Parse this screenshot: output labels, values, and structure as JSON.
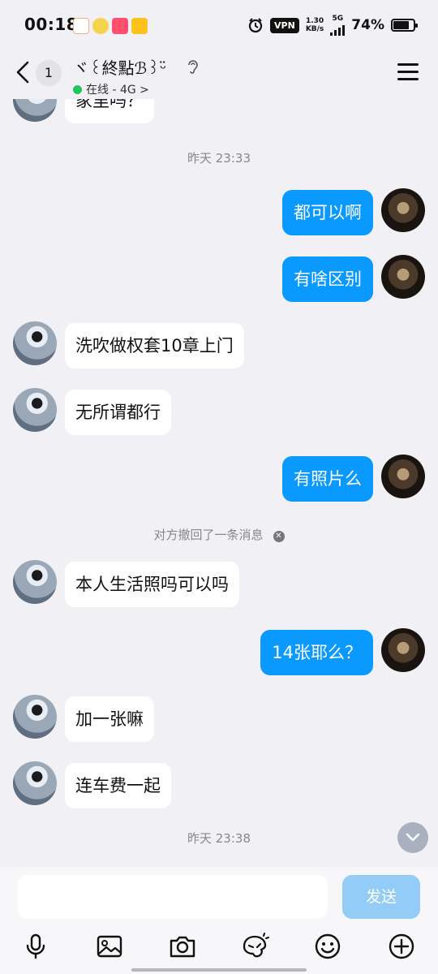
{
  "status_bar": {
    "time": "00:18",
    "vpn": "VPN",
    "speed_value": "1.30",
    "speed_unit": "KB/s",
    "network": "5G",
    "battery": "74%"
  },
  "header": {
    "back_count": "1",
    "chat_name": "ヾ꒰終點ℬ꒱ᵕ̈",
    "status_text": "在线 - 4G >"
  },
  "messages": [
    {
      "side": "left",
      "text": "家里吗？"
    },
    {
      "type": "time",
      "text": "昨天 23:33"
    },
    {
      "side": "right",
      "text": "都可以啊"
    },
    {
      "side": "right",
      "text": "有啥区别"
    },
    {
      "side": "left",
      "text": "洗吹做权套10章上门"
    },
    {
      "side": "left",
      "text": "无所谓都行"
    },
    {
      "side": "right",
      "text": "有照片么"
    },
    {
      "type": "recall",
      "text": "对方撤回了一条消息"
    },
    {
      "side": "left",
      "text": "本人生活照吗可以吗"
    },
    {
      "side": "right",
      "text": "14张耶么？"
    },
    {
      "side": "left",
      "text": "加一张嘛"
    },
    {
      "side": "left",
      "text": "连车费一起"
    },
    {
      "type": "time",
      "text": "昨天 23:38"
    }
  ],
  "input": {
    "value": "",
    "send_label": "发送"
  },
  "toolbar": [
    {
      "icon": "microphone-icon"
    },
    {
      "icon": "image-icon"
    },
    {
      "icon": "camera-icon"
    },
    {
      "icon": "sticker-icon"
    },
    {
      "icon": "emoji-icon"
    },
    {
      "icon": "plus-icon"
    }
  ],
  "colors": {
    "background": "#f1f1f5",
    "outgoing_bubble": "#0a99ff",
    "incoming_bubble": "#ffffff",
    "send_button": "#93cdf7",
    "online_dot": "#22c55e"
  }
}
